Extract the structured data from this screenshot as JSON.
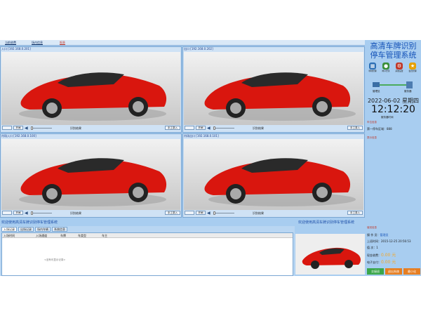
{
  "tabs": [
    "当前收费",
    "场内信息",
    "报表"
  ],
  "cameras": [
    {
      "label": "入口 [192.168.0.201]",
      "open": "开闸",
      "result": "识别结果",
      "manual": "手工录入"
    },
    {
      "label": "出口 [192.168.0.202]",
      "open": "开闸",
      "result": "识别结果",
      "manual": "手工录入"
    },
    {
      "label": "内场入口 [192.168.0.100]",
      "open": "开闸",
      "result": "识别结果",
      "manual": "手工录入"
    },
    {
      "label": "内场出口 [192.168.0.101]",
      "open": "开闸",
      "result": "识别结果",
      "manual": "手工录入"
    }
  ],
  "welcome_left": "欢迎使用高清车牌识别停车管理系统",
  "welcome_right": "欢迎使用高清车牌识别停车管理系统",
  "bottom_tabs": [
    "入场记录",
    "出场记录",
    "场内车辆",
    "系统信息"
  ],
  "grid_columns": [
    "入场时间",
    "入场通道",
    "车牌",
    "车类型",
    "车主"
  ],
  "grid_empty": "<没有可显示记录>",
  "side": {
    "title_line1": "高清车牌识别",
    "title_line2": "停车管理系统",
    "tools": [
      "场地管理",
      "岗亭登录",
      "系统设置",
      "会员管理"
    ],
    "net_left": "管理处",
    "net_right": "服务器",
    "date": "2022-06-02 星期四",
    "time": "12:12:20",
    "time_note": "服务器时间",
    "status_section": "车位信息",
    "status_line": "第一停车区域：888",
    "notice_section": "提示信息",
    "duty_section": "值班信息",
    "operator_label": "操 作 员：",
    "operator": "管理员",
    "login_label": "上班时间：",
    "login_time": "2015-12-25 20:56:53",
    "count_label": "值 次：",
    "count": "1",
    "cash_label": "现金收费：",
    "cash": "0.00 元",
    "epay_label": "电子支付：",
    "epay": "0.00 元",
    "btn_handover": "交接班",
    "btn_exit": "退出系统",
    "btn_min": "最小化"
  },
  "colors": {
    "accent": "#1553b8",
    "money": "#f5a623",
    "btn_green": "#3aa64a",
    "btn_orange": "#e67e22"
  }
}
